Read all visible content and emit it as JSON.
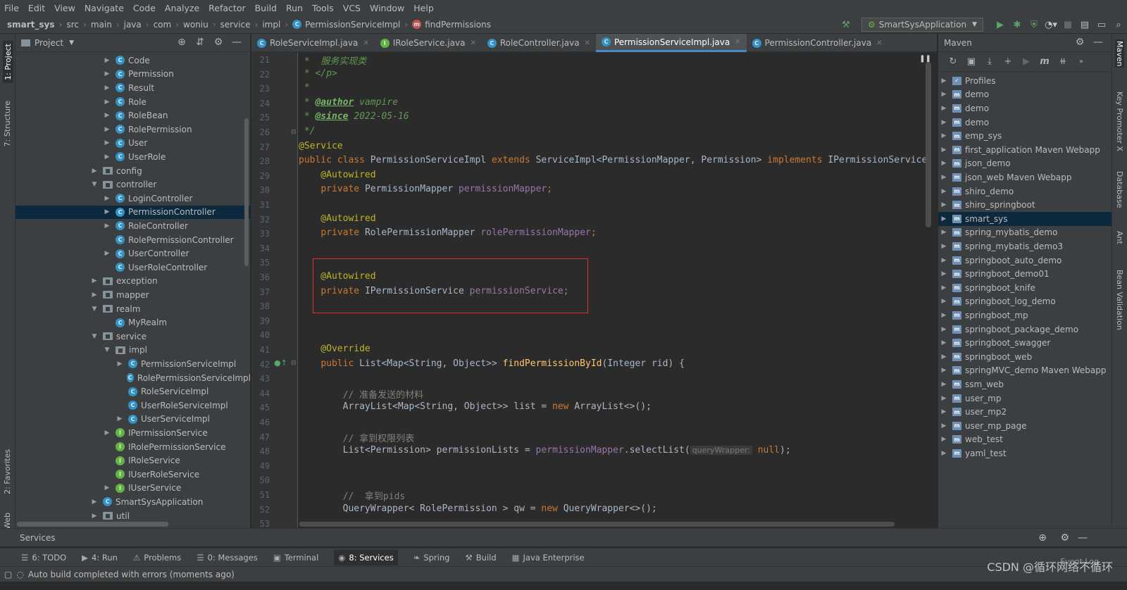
{
  "menu": [
    "File",
    "Edit",
    "View",
    "Navigate",
    "Code",
    "Analyze",
    "Refactor",
    "Build",
    "Run",
    "Tools",
    "VCS",
    "Window",
    "Help"
  ],
  "breadcrumbs": [
    "smart_sys",
    "src",
    "main",
    "java",
    "com",
    "woniu",
    "service",
    "impl",
    "PermissionServiceImpl",
    "findPermissions"
  ],
  "run_config": "SmartSysApplication",
  "left_strip": [
    "1: Project",
    "7: Structure",
    "2: Favorites",
    "Web"
  ],
  "right_strip": [
    "Maven",
    "Key Promoter X",
    "Database",
    "Ant",
    "Bean Validation"
  ],
  "project_panel": {
    "title": "Project",
    "items": [
      {
        "label": "Code",
        "type": "class",
        "indent": 2,
        "arrow": "right"
      },
      {
        "label": "Permission",
        "type": "class",
        "indent": 2,
        "arrow": "right"
      },
      {
        "label": "Result",
        "type": "class",
        "indent": 2,
        "arrow": "right"
      },
      {
        "label": "Role",
        "type": "class",
        "indent": 2,
        "arrow": "right"
      },
      {
        "label": "RoleBean",
        "type": "class",
        "indent": 2,
        "arrow": "right"
      },
      {
        "label": "RolePermission",
        "type": "class",
        "indent": 2,
        "arrow": "right"
      },
      {
        "label": "User",
        "type": "class",
        "indent": 2,
        "arrow": "right"
      },
      {
        "label": "UserRole",
        "type": "class",
        "indent": 2,
        "arrow": "right"
      },
      {
        "label": "config",
        "type": "folder",
        "indent": 1,
        "arrow": "right"
      },
      {
        "label": "controller",
        "type": "folder",
        "indent": 1,
        "arrow": "down"
      },
      {
        "label": "LoginController",
        "type": "class",
        "indent": 2,
        "arrow": "right"
      },
      {
        "label": "PermissionController",
        "type": "class",
        "indent": 2,
        "arrow": "right",
        "selected": true
      },
      {
        "label": "RoleController",
        "type": "class",
        "indent": 2,
        "arrow": "right"
      },
      {
        "label": "RolePermissionController",
        "type": "class",
        "indent": 2,
        "arrow": ""
      },
      {
        "label": "UserController",
        "type": "class",
        "indent": 2,
        "arrow": "right"
      },
      {
        "label": "UserRoleController",
        "type": "class",
        "indent": 2,
        "arrow": ""
      },
      {
        "label": "exception",
        "type": "folder",
        "indent": 1,
        "arrow": "right"
      },
      {
        "label": "mapper",
        "type": "folder",
        "indent": 1,
        "arrow": "right"
      },
      {
        "label": "realm",
        "type": "folder",
        "indent": 1,
        "arrow": "down"
      },
      {
        "label": "MyRealm",
        "type": "class",
        "indent": 2,
        "arrow": ""
      },
      {
        "label": "service",
        "type": "folder",
        "indent": 1,
        "arrow": "down"
      },
      {
        "label": "impl",
        "type": "folder",
        "indent": 2,
        "arrow": "down"
      },
      {
        "label": "PermissionServiceImpl",
        "type": "class",
        "indent": 3,
        "arrow": "right"
      },
      {
        "label": "RolePermissionServiceImpl",
        "type": "class",
        "indent": 3,
        "arrow": ""
      },
      {
        "label": "RoleServiceImpl",
        "type": "class",
        "indent": 3,
        "arrow": ""
      },
      {
        "label": "UserRoleServiceImpl",
        "type": "class",
        "indent": 3,
        "arrow": ""
      },
      {
        "label": "UserServiceImpl",
        "type": "class",
        "indent": 3,
        "arrow": "right"
      },
      {
        "label": "IPermissionService",
        "type": "interface",
        "indent": 2,
        "arrow": "right"
      },
      {
        "label": "IRolePermissionService",
        "type": "interface",
        "indent": 2,
        "arrow": ""
      },
      {
        "label": "IRoleService",
        "type": "interface",
        "indent": 2,
        "arrow": ""
      },
      {
        "label": "IUserRoleService",
        "type": "interface",
        "indent": 2,
        "arrow": ""
      },
      {
        "label": "IUserService",
        "type": "interface",
        "indent": 2,
        "arrow": "right"
      },
      {
        "label": "SmartSysApplication",
        "type": "class",
        "indent": 1,
        "arrow": "right"
      },
      {
        "label": "util",
        "type": "folder",
        "indent": 1,
        "arrow": "right"
      }
    ]
  },
  "editor_tabs": [
    {
      "label": "RoleServiceImpl.java",
      "icon": "C"
    },
    {
      "label": "IRoleService.java",
      "icon": "I"
    },
    {
      "label": "RoleController.java",
      "icon": "C"
    },
    {
      "label": "PermissionServiceImpl.java",
      "icon": "C",
      "active": true
    },
    {
      "label": "PermissionController.java",
      "icon": "C"
    }
  ],
  "line_numbers": [
    "21",
    "22",
    "23",
    "24",
    "25",
    "26",
    "27",
    "28",
    "29",
    "30",
    "31",
    "32",
    "33",
    "34",
    "35",
    "36",
    "37",
    "38",
    "39",
    "40",
    "41",
    "42",
    "43",
    "44",
    "45",
    "46",
    "47",
    "48",
    "49",
    "50",
    "51",
    "52",
    "53"
  ],
  "code_lines": [
    [
      {
        "t": " *  服务实现类",
        "c": "dc"
      }
    ],
    [
      {
        "t": " * </p>",
        "c": "dc"
      }
    ],
    [
      {
        "t": " *",
        "c": "dc"
      }
    ],
    [
      {
        "t": " * ",
        "c": "dc"
      },
      {
        "t": "@author",
        "c": "tg"
      },
      {
        "t": " vampire",
        "c": "dc"
      }
    ],
    [
      {
        "t": " * ",
        "c": "dc"
      },
      {
        "t": "@since",
        "c": "tg"
      },
      {
        "t": " 2022-05-16",
        "c": "dc"
      }
    ],
    [
      {
        "t": " */",
        "c": "dc"
      }
    ],
    [
      {
        "t": "@Service",
        "c": "an"
      }
    ],
    [
      {
        "t": "public class ",
        "c": "kw"
      },
      {
        "t": "PermissionServiceImpl ",
        "c": ""
      },
      {
        "t": "extends ",
        "c": "kw"
      },
      {
        "t": "ServiceImpl<PermissionMapper, Permission> ",
        "c": ""
      },
      {
        "t": "implements ",
        "c": "kw"
      },
      {
        "t": "IPermissionService",
        "c": ""
      }
    ],
    [
      {
        "t": "    @Autowired",
        "c": "an"
      }
    ],
    [
      {
        "t": "    ",
        "c": ""
      },
      {
        "t": "private ",
        "c": "kw"
      },
      {
        "t": "PermissionMapper ",
        "c": ""
      },
      {
        "t": "permissionMapper",
        "c": "fd"
      },
      {
        "t": ";",
        "c": "kw"
      }
    ],
    [],
    [
      {
        "t": "    @Autowired",
        "c": "an"
      }
    ],
    [
      {
        "t": "    ",
        "c": ""
      },
      {
        "t": "private ",
        "c": "kw"
      },
      {
        "t": "RolePermissionMapper ",
        "c": ""
      },
      {
        "t": "rolePermissionMapper",
        "c": "fd"
      },
      {
        "t": ";",
        "c": "kw"
      }
    ],
    [],
    [],
    [
      {
        "t": "    @Autowired",
        "c": "an"
      }
    ],
    [
      {
        "t": "    ",
        "c": ""
      },
      {
        "t": "private ",
        "c": "kw"
      },
      {
        "t": "IPermissionService ",
        "c": ""
      },
      {
        "t": "permissionService",
        "c": "fd"
      },
      {
        "t": ";",
        "c": "kw"
      }
    ],
    [],
    [],
    [],
    [
      {
        "t": "    @Override",
        "c": "an"
      }
    ],
    [
      {
        "t": "    ",
        "c": ""
      },
      {
        "t": "public ",
        "c": "kw"
      },
      {
        "t": "List<Map<String, Object>> ",
        "c": ""
      },
      {
        "t": "findPermissionById",
        "c": "fn"
      },
      {
        "t": "(Integer rid) {",
        "c": ""
      }
    ],
    [],
    [
      {
        "t": "        // 准备发送的材料",
        "c": "cm"
      }
    ],
    [
      {
        "t": "        ArrayList<Map<String, Object>> list = ",
        "c": ""
      },
      {
        "t": "new ",
        "c": "kw"
      },
      {
        "t": "ArrayList<>();",
        "c": ""
      }
    ],
    [],
    [
      {
        "t": "        // 拿到权限列表",
        "c": "cm"
      }
    ],
    [
      {
        "t": "        List<Permission> permissionLists = ",
        "c": ""
      },
      {
        "t": "permissionMapper",
        "c": "fd"
      },
      {
        "t": ".selectList(",
        "c": ""
      },
      {
        "t": "queryWrapper:",
        "c": "hint"
      },
      {
        "t": " null",
        "c": "kw"
      },
      {
        "t": ");",
        "c": ""
      }
    ],
    [],
    [],
    [
      {
        "t": "        //  拿到pids",
        "c": "cm"
      }
    ],
    [
      {
        "t": "        QueryWrapper< RolePermission > qw = ",
        "c": ""
      },
      {
        "t": "new ",
        "c": "kw"
      },
      {
        "t": "QueryWrapper<>();",
        "c": ""
      }
    ],
    []
  ],
  "maven_panel": {
    "title": "Maven",
    "items": [
      {
        "label": "Profiles",
        "type": "profiles"
      },
      {
        "label": "demo"
      },
      {
        "label": "demo"
      },
      {
        "label": "demo"
      },
      {
        "label": "emp_sys"
      },
      {
        "label": "first_application Maven Webapp"
      },
      {
        "label": "json_demo"
      },
      {
        "label": "json_web Maven Webapp"
      },
      {
        "label": "shiro_demo"
      },
      {
        "label": "shiro_springboot"
      },
      {
        "label": "smart_sys",
        "selected": true
      },
      {
        "label": "spring_mybatis_demo"
      },
      {
        "label": "spring_mybatis_demo3"
      },
      {
        "label": "springboot_auto_demo"
      },
      {
        "label": "springboot_demo01"
      },
      {
        "label": "springboot_knife"
      },
      {
        "label": "springboot_log_demo"
      },
      {
        "label": "springboot_mp"
      },
      {
        "label": "springboot_package_demo"
      },
      {
        "label": "springboot_swagger"
      },
      {
        "label": "springboot_web"
      },
      {
        "label": "springMVC_demo Maven Webapp"
      },
      {
        "label": "ssm_web"
      },
      {
        "label": "user_mp"
      },
      {
        "label": "user_mp2"
      },
      {
        "label": "user_mp_page"
      },
      {
        "label": "web_test"
      },
      {
        "label": "yaml_test"
      }
    ]
  },
  "services_label": "Services",
  "bottom_tabs": [
    {
      "label": "6: TODO",
      "icon": "☰"
    },
    {
      "label": "4: Run",
      "icon": "▶"
    },
    {
      "label": "Problems",
      "icon": "⚠"
    },
    {
      "label": "0: Messages",
      "icon": "☰"
    },
    {
      "label": "Terminal",
      "icon": "▣"
    },
    {
      "label": "8: Services",
      "icon": "◉",
      "active": true
    },
    {
      "label": "Spring",
      "icon": "❧"
    },
    {
      "label": "Build",
      "icon": "⚒"
    },
    {
      "label": "Java Enterprise",
      "icon": "▦"
    }
  ],
  "event_log": "Event Log",
  "status_text": "Auto build completed with errors (moments ago)",
  "watermark": "CSDN @循环网络不循环"
}
